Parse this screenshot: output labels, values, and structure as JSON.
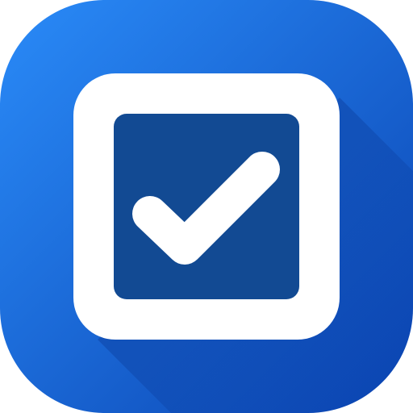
{
  "icon": {
    "name": "checkbox-checked-icon",
    "colors": {
      "gradient_start": "#2a8bf8",
      "gradient_end": "#0a43b1",
      "long_shadow": "#062f8a",
      "frame": "#ffffff",
      "inner_square": "#124a93",
      "checkmark": "#ffffff"
    }
  }
}
